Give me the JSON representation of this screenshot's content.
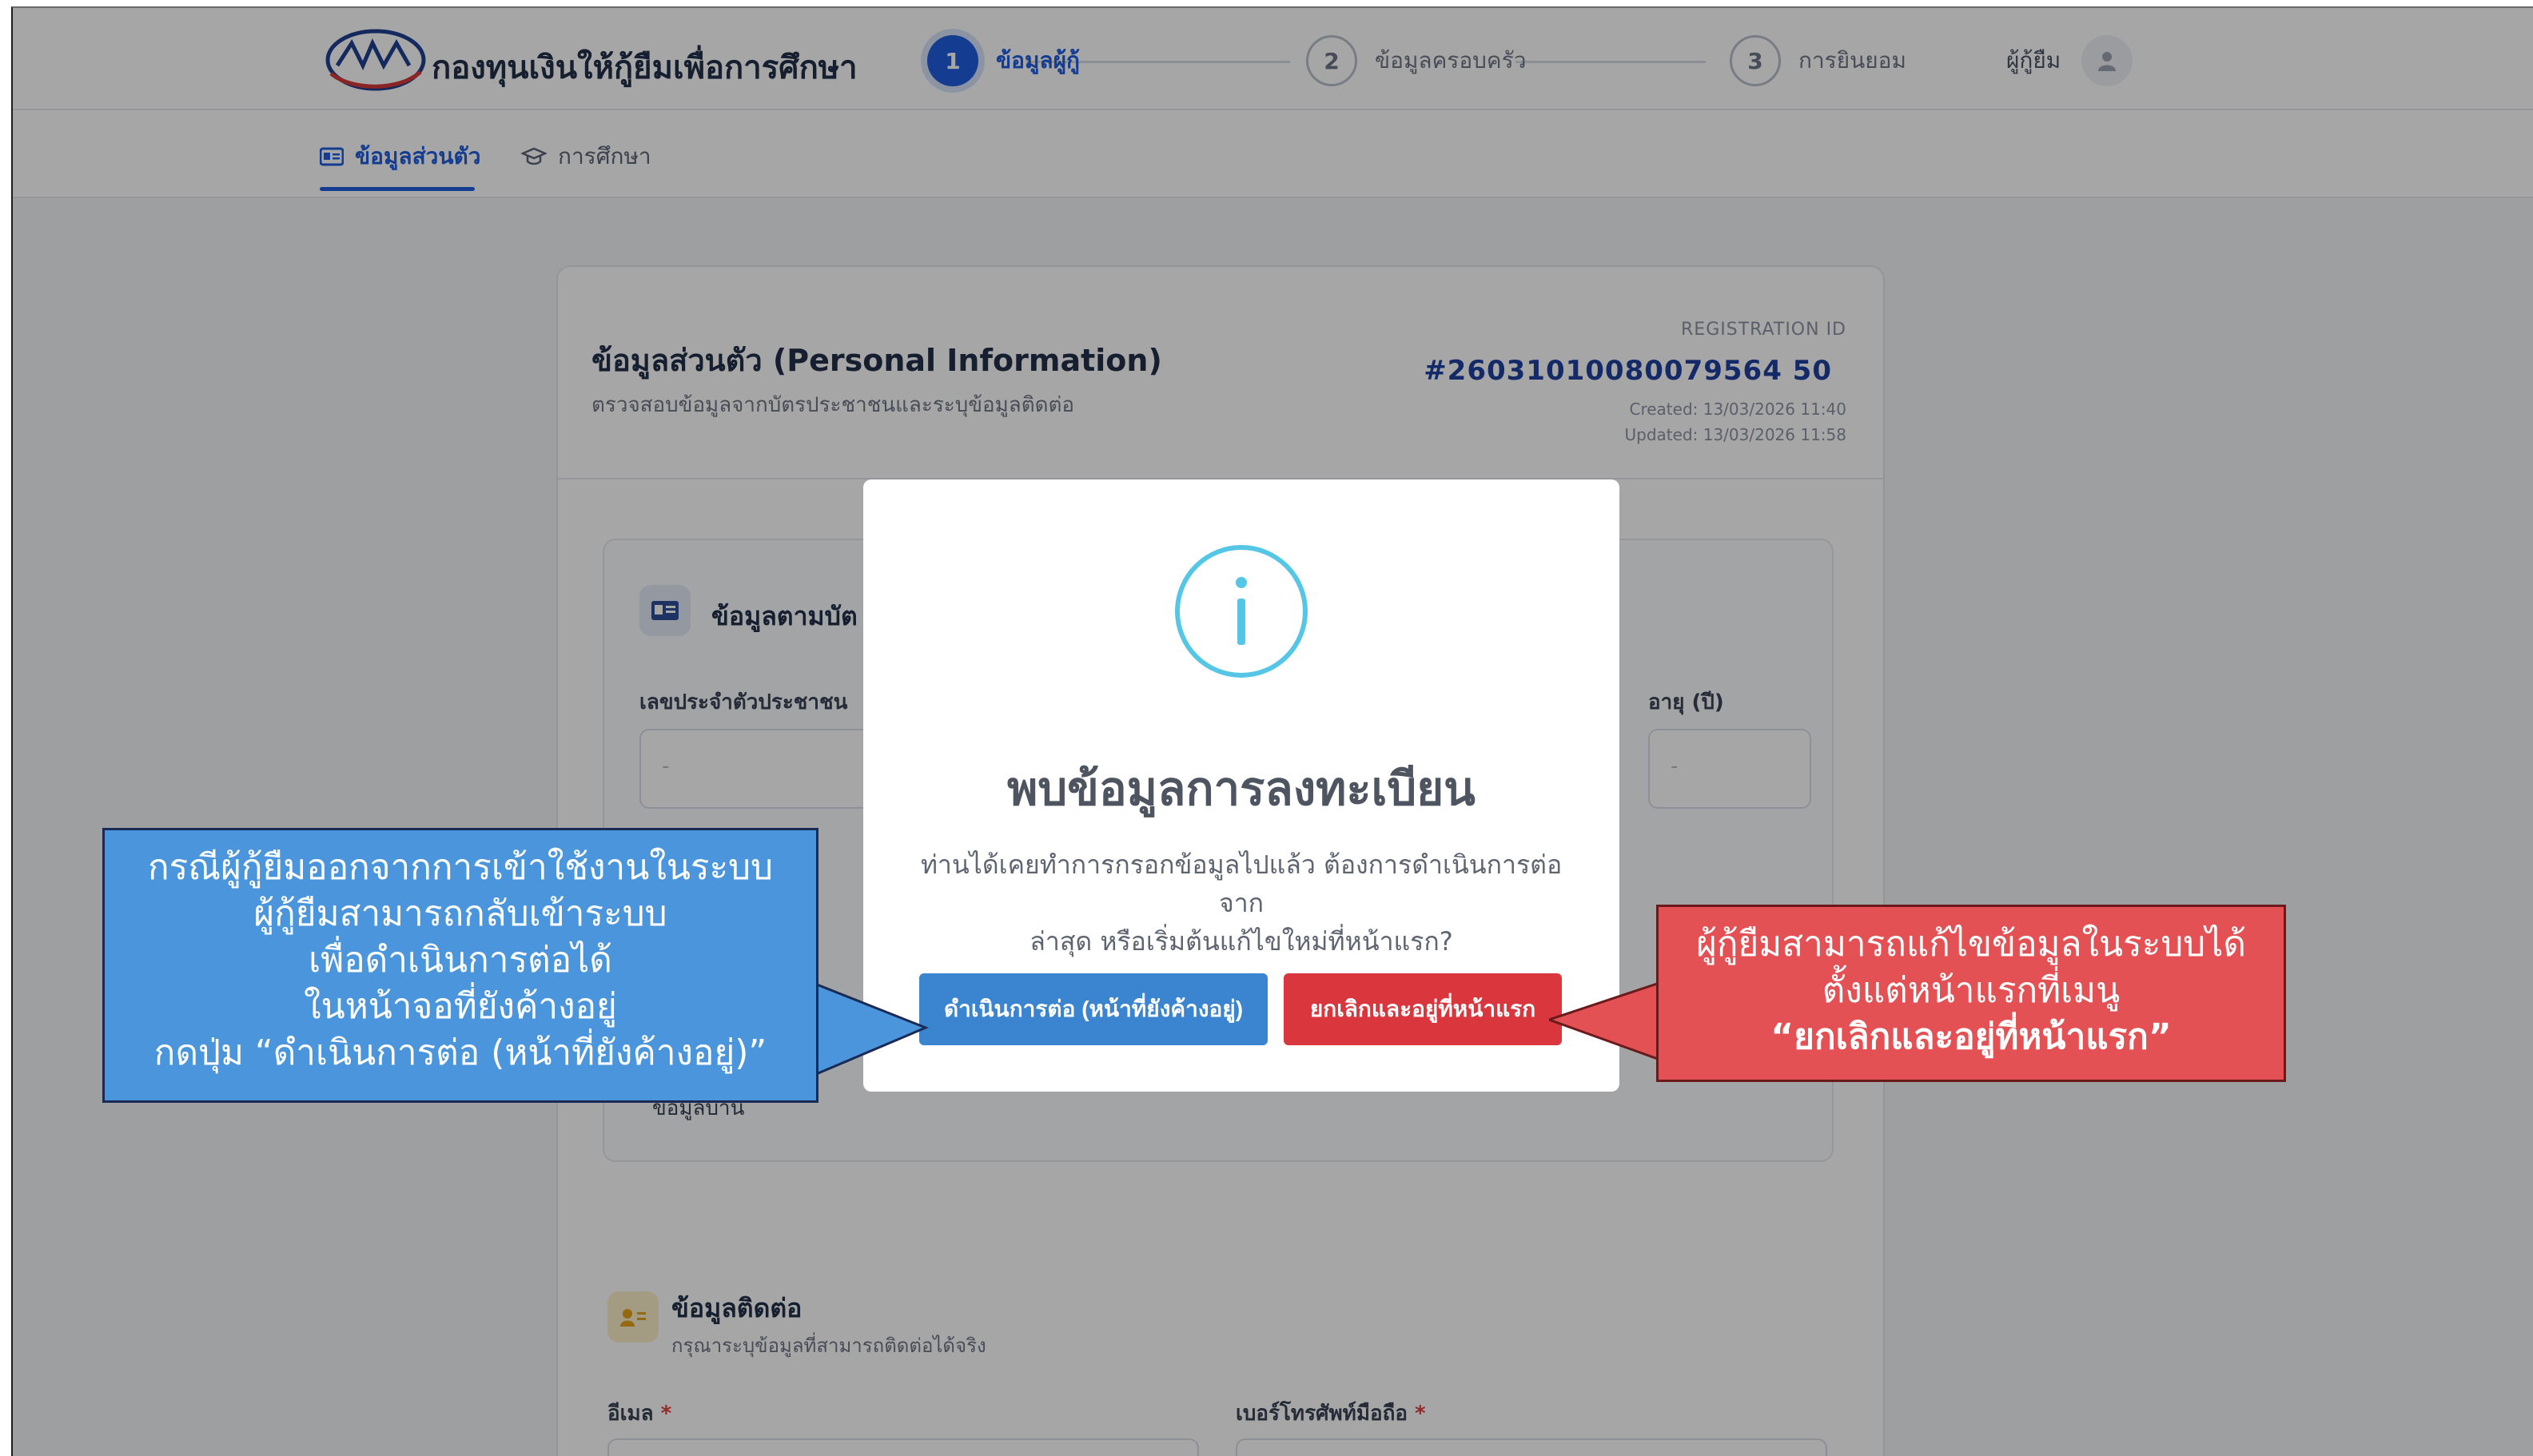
{
  "header": {
    "brand": "กองทุนเงินให้กู้ยืมเพื่อการศึกษา",
    "steps": [
      {
        "num": "1",
        "label": "ข้อมูลผู้กู้"
      },
      {
        "num": "2",
        "label": "ข้อมูลครอบครัว"
      },
      {
        "num": "3",
        "label": "การยินยอม"
      }
    ],
    "user_label": "ผู้กู้ยืม"
  },
  "subnav": {
    "tabs": [
      {
        "label": "ข้อมูลส่วนตัว"
      },
      {
        "label": "การศึกษา"
      }
    ]
  },
  "card": {
    "title": "ข้อมูลส่วนตัว (Personal Information)",
    "subtitle": "ตรวจสอบข้อมูลจากบัตรประชาชนและระบุข้อมูลติดต่อ",
    "registration_label": "REGISTRATION ID",
    "registration_id": "#26031010080079564 50",
    "created": "Created: 13/03/2026 11:40",
    "updated": "Updated: 13/03/2026 11:58",
    "section1": {
      "title": "ข้อมูลตามบัต",
      "field_id_label": "เลขประจำตัวประชาชน",
      "field_age_label": "อายุ (ปี)",
      "field_id_value": "-",
      "field_age_value": "-",
      "footer_label": "ข้อมูลบ้าน"
    },
    "section2": {
      "title": "ข้อมูลติดต่อ",
      "subtitle": "กรุณาระบุข้อมูลที่สามารถติดต่อได้จริง",
      "email_label": "อีเมล",
      "phone_label": "เบอร์โทรศัพท์มือถือ",
      "required_mark": "*"
    }
  },
  "modal": {
    "title": "พบข้อมูลการลงทะเบียน",
    "text_line1": "ท่านได้เคยทำการกรอกข้อมูลไปแล้ว ต้องการดำเนินการต่อจาก",
    "text_line2": "ล่าสุด หรือเริ่มต้นแก้ไขใหม่ที่หน้าแรก?",
    "continue_button": "ดำเนินการต่อ (หน้าที่ยังค้างอยู่)",
    "cancel_button": "ยกเลิกและอยู่ที่หน้าแรก"
  },
  "callouts": {
    "blue_lines": [
      "กรณีผู้กู้ยืมออกจากการเข้าใช้งานในระบบ",
      "ผู้กู้ยืมสามารถกลับเข้าระบบ",
      "เพื่อดำเนินการต่อได้",
      "ในหน้าจอที่ยังค้างอยู่",
      "กดปุ่ม “ดำเนินการต่อ (หน้าที่ยังค้างอยู่)”"
    ],
    "red_lines": [
      "ผู้กู้ยืมสามารถแก้ไขข้อมูลในระบบได้",
      "ตั้งแต่หน้าแรกที่เมนู",
      "“ยกเลิกและอยู่ที่หน้าแรก”"
    ]
  },
  "colors": {
    "primary": "#1f5fe0",
    "info_icon": "#55c6e6",
    "continue_button": "#3b84cf",
    "cancel_button": "#d9363d",
    "callout_blue": "#4a95dc",
    "callout_red": "#e35154"
  }
}
